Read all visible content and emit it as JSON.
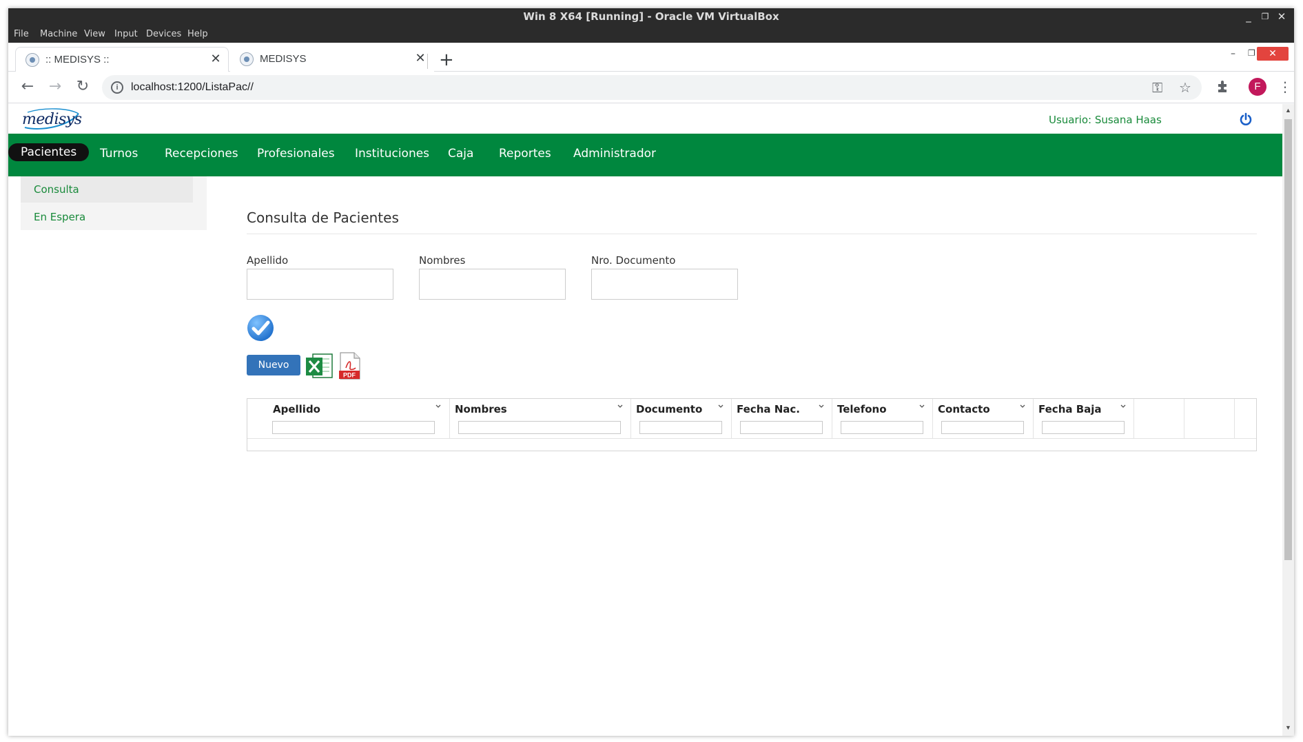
{
  "vbox": {
    "title": "Win 8 X64 [Running] - Oracle VM VirtualBox",
    "menu": [
      "File",
      "Machine",
      "View",
      "Input",
      "Devices",
      "Help"
    ]
  },
  "browser": {
    "tabs": [
      {
        "title": ":: MEDISYS ::",
        "active": true
      },
      {
        "title": "MEDISYS",
        "active": false
      }
    ],
    "url": "localhost:1200/ListaPac//",
    "profile_initial": "F"
  },
  "app": {
    "logo_text": "medisys",
    "user_label": "Usuario: Susana Haas",
    "brand_color": "#00873e",
    "nav": [
      "Pacientes",
      "Turnos",
      "Recepciones",
      "Profesionales",
      "Instituciones",
      "Caja",
      "Reportes",
      "Administrador"
    ],
    "nav_active": "Pacientes",
    "side_menu": [
      {
        "label": "Consulta",
        "selected": true
      },
      {
        "label": "En Espera",
        "selected": false
      }
    ]
  },
  "content": {
    "title": "Consulta de Pacientes",
    "fields": [
      {
        "label": "Apellido",
        "value": ""
      },
      {
        "label": "Nombres",
        "value": ""
      },
      {
        "label": "Nro. Documento",
        "value": ""
      }
    ],
    "new_button": "Nuevo",
    "export_icons": [
      "excel-icon",
      "pdf-icon"
    ],
    "grid": {
      "columns": [
        "Apellido",
        "Nombres",
        "Documento",
        "Fecha Nac.",
        "Telefono",
        "Contacto",
        "Fecha Baja"
      ],
      "rows": []
    }
  }
}
